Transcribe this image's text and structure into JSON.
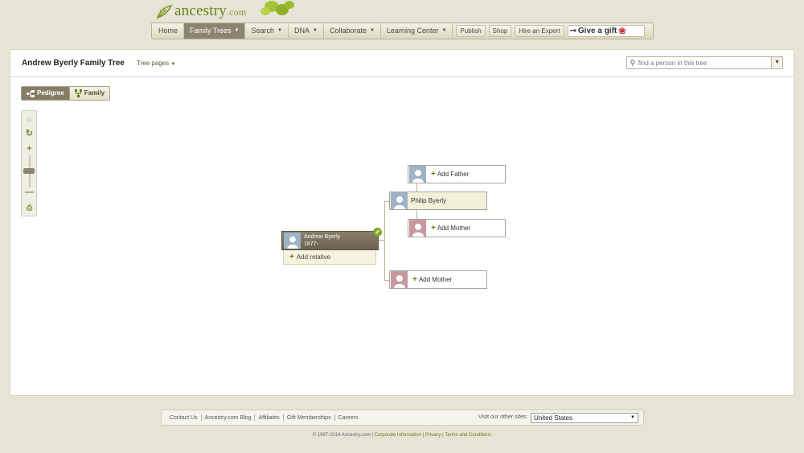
{
  "brand": {
    "logo_text": "ancestry",
    "logo_suffix": ".com"
  },
  "nav": {
    "items": [
      {
        "label": "Home",
        "dropdown": false,
        "active": false
      },
      {
        "label": "Family Trees",
        "dropdown": true,
        "active": true
      },
      {
        "label": "Search",
        "dropdown": true,
        "active": false
      },
      {
        "label": "DNA",
        "dropdown": true,
        "active": false
      },
      {
        "label": "Collaborate",
        "dropdown": true,
        "active": false
      },
      {
        "label": "Learning Center",
        "dropdown": true,
        "active": false
      }
    ],
    "publish": "Publish",
    "shop": "Shop",
    "hire": "Hire an Expert",
    "gift": "Give a gift"
  },
  "tree": {
    "title": "Andrew Byerly Family Tree",
    "pages_label": "Tree pages",
    "search_placeholder": "find a person in this tree"
  },
  "view": {
    "pedigree": "Pedigree",
    "family": "Family"
  },
  "pedigree": {
    "root": {
      "name": "Andrew Byerly",
      "years": "1877-",
      "add_relative": "Add relative"
    },
    "father": {
      "name": "Philip Byerly"
    },
    "grandfather": {
      "label": "Add Father"
    },
    "grandmother": {
      "label": "Add Mother"
    },
    "mother": {
      "label": "Add Mother"
    }
  },
  "footer": {
    "links": [
      "Contact Us",
      "Ancestry.com Blog",
      "Affiliates",
      "Gift Memberships",
      "Careers"
    ],
    "other_sites_label": "Visit our other sites:",
    "country": "United States",
    "copyright": "© 1997-2014 Ancestry.com",
    "corporate": "Corporate Information",
    "privacy": "Privacy",
    "terms": "Terms and Conditions"
  },
  "colors": {
    "accent_green": "#5a7a16",
    "nav_active": "#8c8470",
    "male_avatar": "#9db3c6",
    "female_avatar": "#c7999e",
    "background": "#e6e4d6"
  },
  "icons": [
    "leaf-icon",
    "search-icon",
    "pedigree-icon",
    "family-icon",
    "home-icon",
    "refresh-icon",
    "zoom-in-icon",
    "zoom-out-icon",
    "print-icon",
    "plus-icon",
    "gift-bow-icon"
  ]
}
